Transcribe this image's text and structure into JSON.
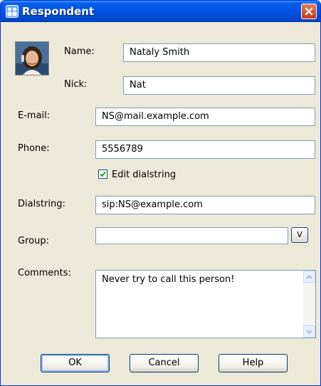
{
  "window": {
    "title": "Respondent",
    "close_icon": "close-icon"
  },
  "form": {
    "name_label": "Name:",
    "name_value": "Nataly Smith",
    "nick_label": "Nick:",
    "nick_value": "Nat",
    "email_label": "E-mail:",
    "email_value": "NS@mail.example.com",
    "phone_label": "Phone:",
    "phone_value": "5556789",
    "edit_dialstring_label": "Edit dialstring",
    "edit_dialstring_checked": true,
    "dialstring_label": "Dialstring:",
    "dialstring_value": "sip:NS@example.com",
    "group_label": "Group:",
    "group_value": "",
    "group_dropdown_label": "V",
    "comments_label": "Comments:",
    "comments_value": "Never try to call this person!"
  },
  "buttons": {
    "ok": "OK",
    "cancel": "Cancel",
    "help": "Help"
  },
  "colors": {
    "titlebar": "#0054e3",
    "face": "#ece9d8",
    "close": "#d6492a",
    "check": "#21a121"
  }
}
